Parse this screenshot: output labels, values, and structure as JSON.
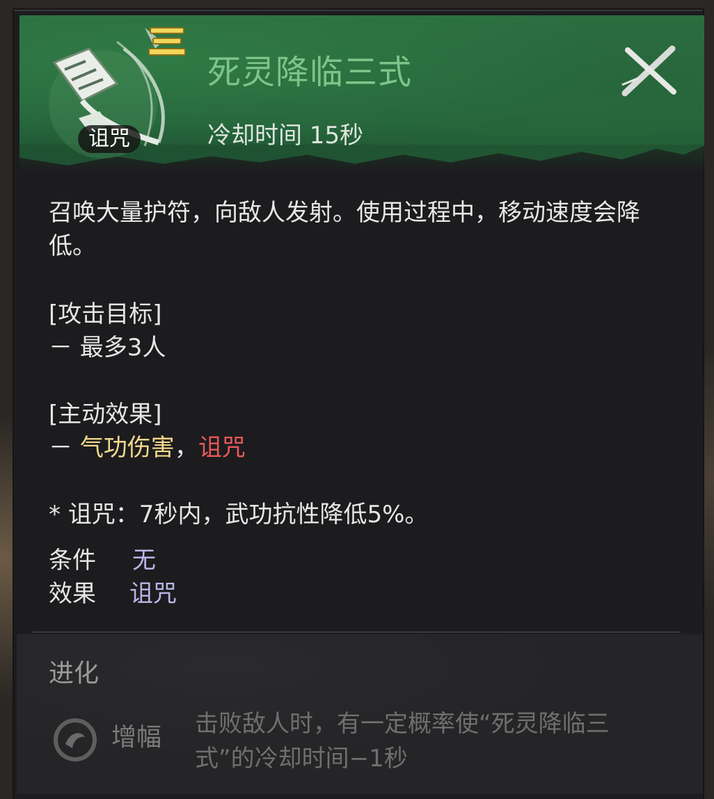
{
  "header": {
    "title": "死灵降临三式",
    "cooldown": "冷却时间 15秒",
    "icon_tag": "诅咒",
    "title_color": "#7dc489",
    "bg_color": "#2c6e3f",
    "rank_icon": "three-bars-icon",
    "close_icon": "close-x-icon"
  },
  "description": "召唤大量护符，向敌人发射。使用过程中，移动速度会降低。",
  "target": {
    "heading": "[攻击目标]",
    "line": "－ 最多3人"
  },
  "active_effect": {
    "heading": "[主动效果]",
    "prefix": "－ ",
    "damage": "气功伤害",
    "separator": "，",
    "curse": "诅咒"
  },
  "note": "* 诅咒：7秒内，武功抗性降低5%。",
  "condition": {
    "label": "条件",
    "value": "无"
  },
  "effect": {
    "label": "效果",
    "value": "诅咒"
  },
  "evolution": {
    "title": "进化",
    "name": "增幅",
    "description": "击败敌人时，有一定概率使“死灵降临三式”的冷却时间−1秒",
    "icon": "swirl-icon"
  }
}
